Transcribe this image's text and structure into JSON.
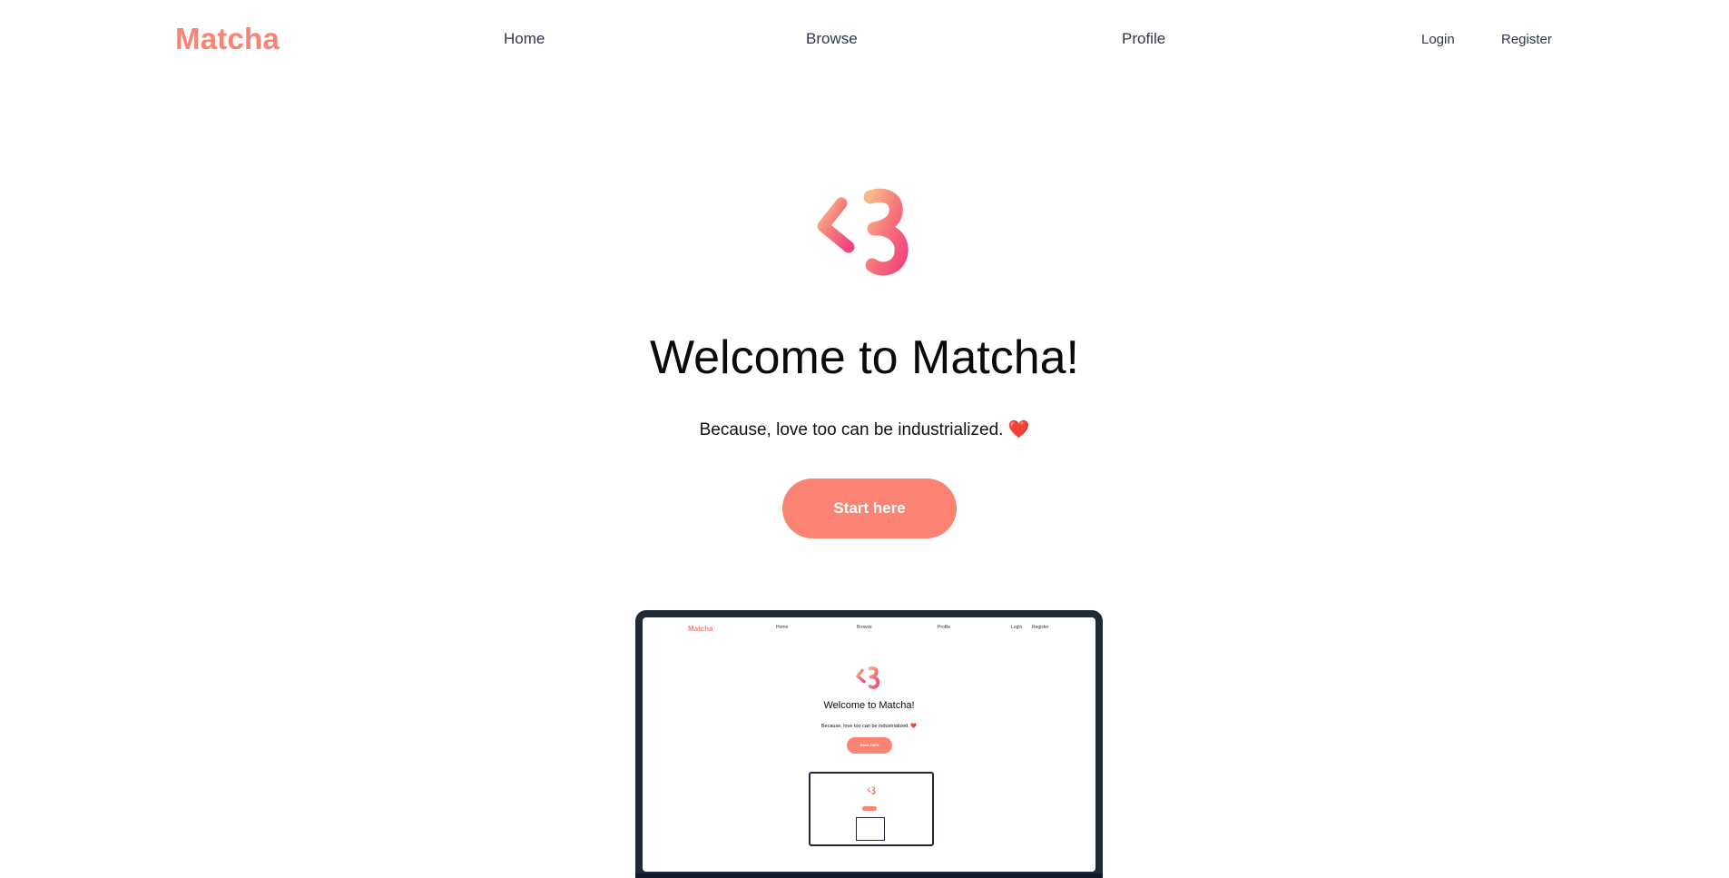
{
  "nav": {
    "brand": "Matcha",
    "links": {
      "home": "Home",
      "browse": "Browse",
      "profile": "Profile"
    },
    "auth": {
      "login": "Login",
      "register": "Register"
    }
  },
  "hero": {
    "logo_icon": "matcha-heart-logo-icon",
    "title": "Welcome to Matcha!",
    "subtitle": "Because, love too can be industrialized. ❤️",
    "cta_label": "Start here"
  },
  "preview": {
    "brand": "Matcha",
    "links": {
      "home": "Home",
      "browse": "Browse",
      "profile": "Profile",
      "login": "Login",
      "register": "Register"
    },
    "title": "Welcome to Matcha!",
    "subtitle": "Because, love too can be industrialized. ❤️",
    "cta_label": "Start here"
  },
  "colors": {
    "accent": "#fb8374",
    "text_nav": "#2d3748",
    "laptop_frame": "#1f2937"
  }
}
